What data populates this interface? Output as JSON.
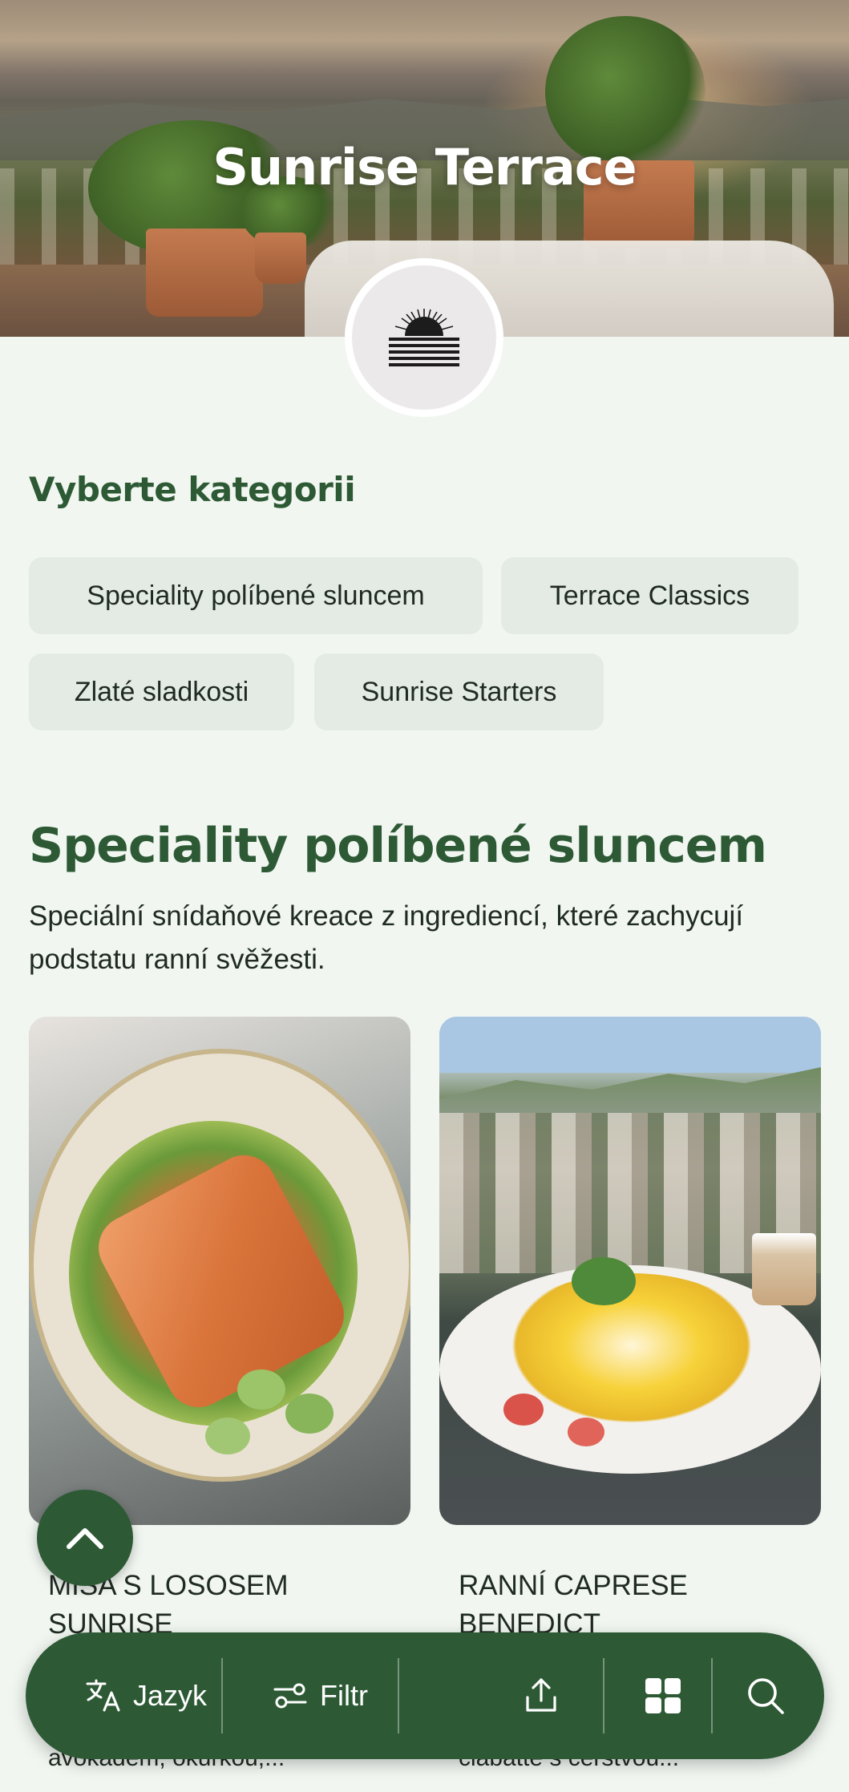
{
  "header": {
    "title": "Sunrise Terrace",
    "logo": "sunrise-logo"
  },
  "categories": {
    "heading": "Vyberte kategorii",
    "items": [
      {
        "label": "Speciality políbené sluncem"
      },
      {
        "label": "Terrace Classics"
      },
      {
        "label": "Zlaté sladkosti"
      },
      {
        "label": "Sunrise Starters"
      }
    ]
  },
  "section": {
    "title": "Speciality políbené sluncem",
    "description": "Speciální snídaňové kreace z ingrediencí, které zachycují podstatu ranní svěžesti."
  },
  "cards": [
    {
      "title": "MISA S LOSOSEM SUNRISE",
      "subtitle": "avokádem, okurkou,..."
    },
    {
      "title": "RANNÍ CAPRESE BENEDICT",
      "subtitle": "ciabatte s čerstvou..."
    }
  ],
  "bottom_bar": {
    "language_label": "Jazyk",
    "filter_label": "Filtr",
    "icons": [
      "translate-icon",
      "filter-icon",
      "share-icon",
      "grid-icon",
      "search-icon",
      "arrow-up-icon"
    ]
  },
  "colors": {
    "accent": "#2d5a35",
    "background": "#f1f6f1",
    "chip": "#e4ebe4"
  }
}
